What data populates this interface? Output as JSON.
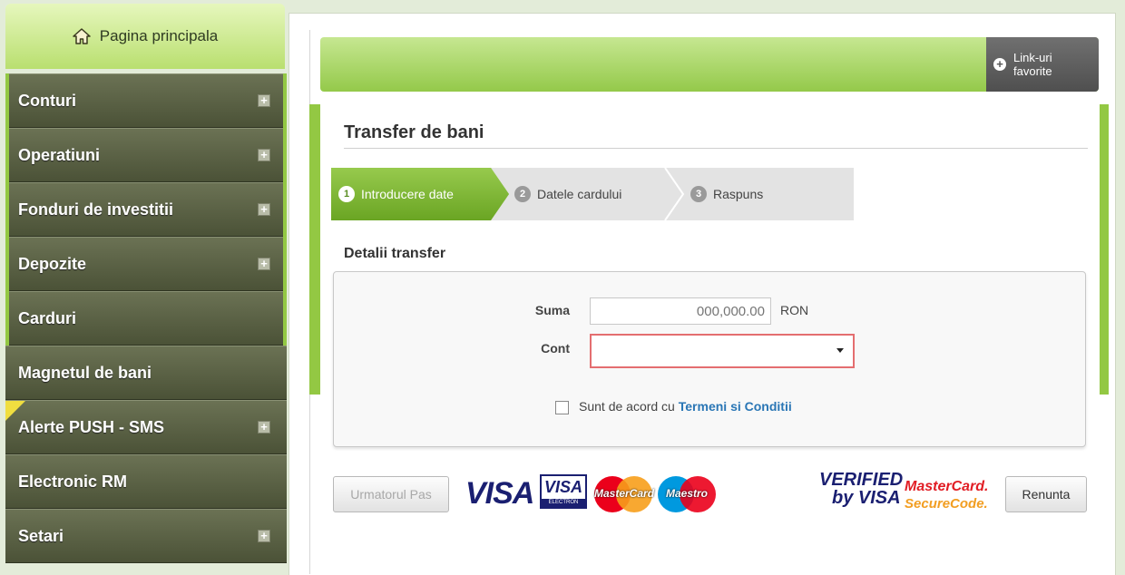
{
  "sidebar": {
    "home_label": "Pagina principala",
    "items": [
      {
        "label": "Conturi"
      },
      {
        "label": "Operatiuni"
      },
      {
        "label": "Fonduri de investitii"
      },
      {
        "label": "Depozite"
      },
      {
        "label": "Carduri"
      },
      {
        "label": "Magnetul de bani"
      },
      {
        "label": "Alerte PUSH - SMS"
      },
      {
        "label": "Electronic RM"
      },
      {
        "label": "Setari"
      }
    ]
  },
  "header": {
    "favorites_line1": "Link-uri",
    "favorites_line2": "favorite"
  },
  "page": {
    "title": "Transfer de bani",
    "steps": [
      {
        "num": "1",
        "label": "Introducere date"
      },
      {
        "num": "2",
        "label": "Datele cardului"
      },
      {
        "num": "3",
        "label": "Raspuns"
      }
    ],
    "section_title": "Detalii transfer"
  },
  "form": {
    "amount_label": "Suma",
    "amount_placeholder": "000,000.00",
    "currency": "RON",
    "account_label": "Cont",
    "agree_text": "Sunt de acord cu",
    "terms_link": "Termeni si Conditii"
  },
  "buttons": {
    "next": "Urmatorul Pas",
    "cancel": "Renunta"
  },
  "logos": {
    "visa": "VISA",
    "visa_electron_top": "VISA",
    "visa_electron_bottom": "ELECTRON",
    "mastercard": "MasterCard",
    "maestro": "Maestro",
    "verified_line1": "VERIFIED",
    "verified_line2": "by VISA",
    "securecode_line1": "MasterCard.",
    "securecode_line2": "SecureCode."
  },
  "colors": {
    "accent_green": "#93c843",
    "sidebar_bg": "#4b5237",
    "link_blue": "#2a76b5",
    "error_border": "#e46e70"
  }
}
